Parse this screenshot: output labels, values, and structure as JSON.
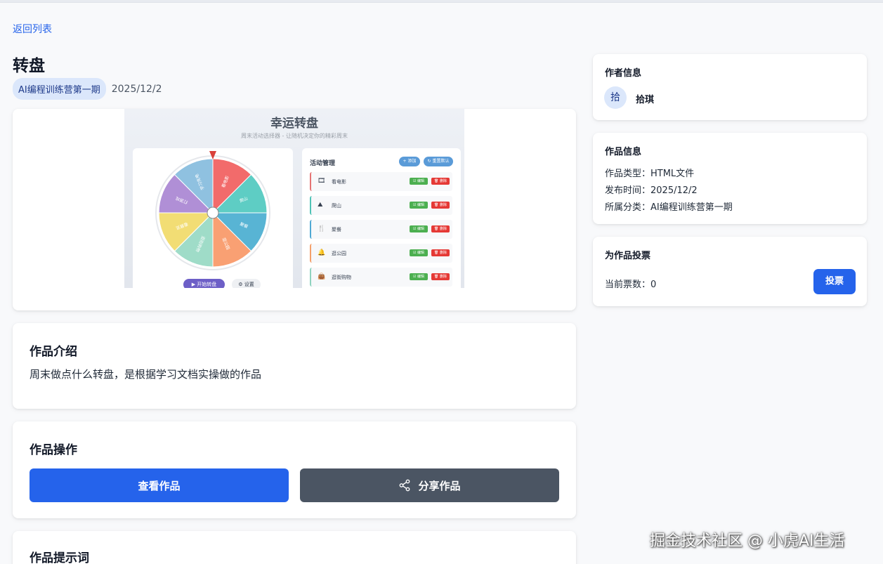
{
  "nav": {
    "back_label": "返回列表"
  },
  "work": {
    "title": "转盘",
    "category_tag": "AI编程训练营第一期",
    "date": "2025/12/2"
  },
  "preview": {
    "app_title": "幸运转盘",
    "app_subtitle": "周末活动选择器 - 让随机决定你的精彩周末",
    "wheel_segments": [
      {
        "label": "看电影",
        "color": "#f26b6b"
      },
      {
        "label": "爬山",
        "color": "#5ecdc4"
      },
      {
        "label": "聚餐",
        "color": "#58b4d4"
      },
      {
        "label": "逛公园",
        "color": "#f9a073"
      },
      {
        "label": "逛街购物",
        "color": "#9fdcc8"
      },
      {
        "label": "看展览",
        "color": "#f2dd74"
      },
      {
        "label": "打游戏",
        "color": "#b08fd6"
      },
      {
        "label": "学习充电",
        "color": "#8fc1e0"
      }
    ],
    "spin_label": "▶ 开始转盘",
    "settings_label": "⚙ 设置",
    "list_title": "活动管理",
    "add_label": "+ 添加",
    "reset_label": "↻ 重置默认",
    "edit_label": "☑ 编辑",
    "delete_label": "🗑 删除",
    "activities": [
      {
        "icon": "🎞",
        "name": "看电影",
        "accent": "#e57373"
      },
      {
        "icon": "⛰",
        "name": "爬山",
        "accent": "#4fc3b6"
      },
      {
        "icon": "🍴",
        "name": "聚餐",
        "accent": "#4fa8d4"
      },
      {
        "icon": "🔔",
        "name": "逛公园",
        "accent": "#f4a06b"
      },
      {
        "icon": "👜",
        "name": "逛街购物",
        "accent": "#8fd3bf"
      }
    ]
  },
  "intro": {
    "heading": "作品介绍",
    "text": "周末做点什么转盘，是根据学习文档实操做的作品"
  },
  "operations": {
    "heading": "作品操作",
    "view_label": "查看作品",
    "share_label": "分享作品"
  },
  "prompt": {
    "heading": "作品提示词"
  },
  "author": {
    "heading": "作者信息",
    "avatar_char": "拾",
    "name": "拾琪"
  },
  "info": {
    "heading": "作品信息",
    "type_line": "作品类型：HTML文件",
    "time_line": "发布时间：2025/12/2",
    "category_line": "所属分类：AI编程训练营第一期"
  },
  "vote": {
    "heading": "为作品投票",
    "count_text": "当前票数：0",
    "vote_label": "投票"
  },
  "watermark": "掘金技术社区 @ 小虎AI生活",
  "colors": {
    "primary": "#2563eb",
    "secondary_button": "#4b5563",
    "chip_bg": "#dbe7fb"
  }
}
